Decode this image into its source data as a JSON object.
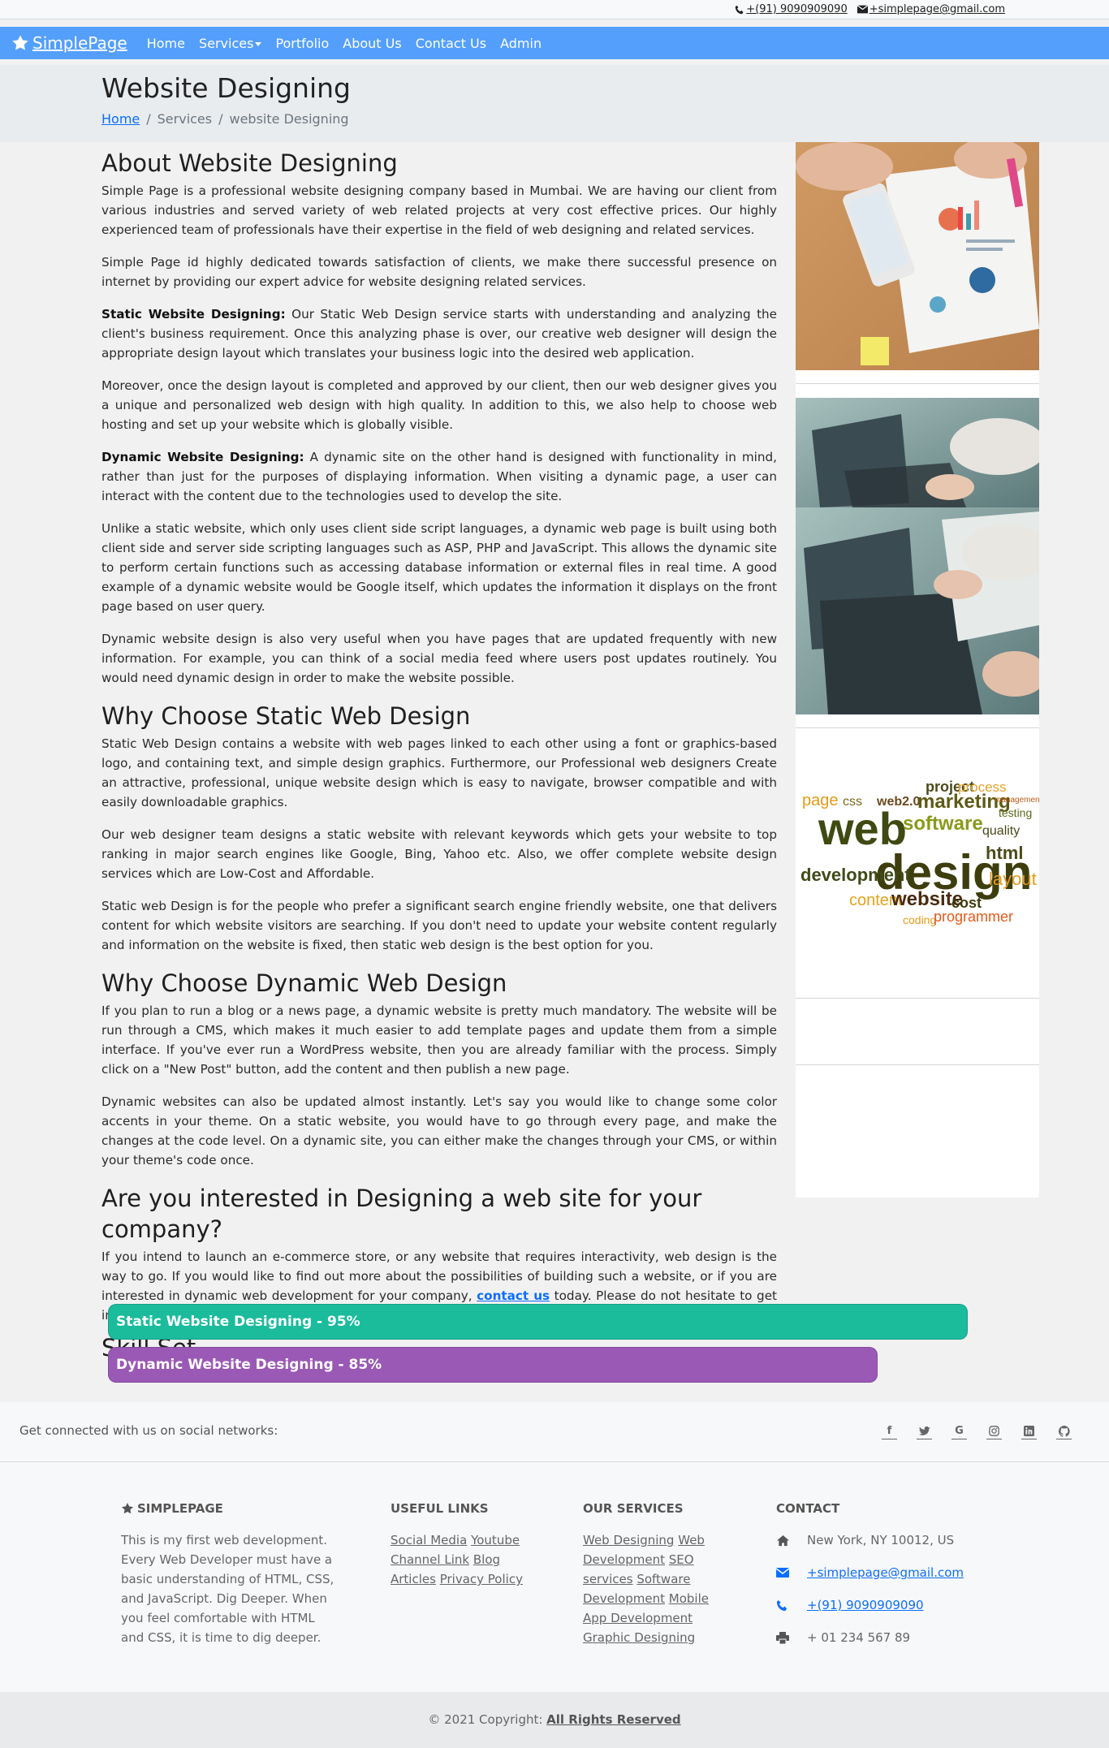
{
  "topbar": {
    "phone": "+(91) 9090909090",
    "email": "+simplepage@gmail.com"
  },
  "nav": {
    "brand": "SimplePage",
    "items": [
      "Home",
      "Services",
      "Portfolio",
      "About Us",
      "Contact Us",
      "Admin"
    ]
  },
  "header": {
    "title": "Website Designing",
    "breadcrumb": [
      "Home",
      "Services",
      "website Designing"
    ]
  },
  "about": {
    "heading": "About Website Designing",
    "p1": "Simple Page is a professional website designing company based in Mumbai. We are having our client from various industries and served variety of web related projects at very cost effective prices. Our highly experienced team of professionals have their expertise in the field of web designing and related services.",
    "p2": "Simple Page id highly dedicated towards satisfaction of clients, we make there successful presence on internet by providing our expert advice for website designing related services.",
    "static_label": "Static Website Designing:",
    "static_text": " Our Static Web Design service starts with understanding and analyzing the client's business requirement. Once this analyzing phase is over, our creative web designer will design the appropriate design layout which translates your business logic into the desired web application.",
    "p4": "Moreover, once the design layout is completed and approved by our client, then our web designer gives you a unique and personalized web design with high quality. In addition to this, we also help to choose web hosting and set up your website which is globally visible.",
    "dynamic_label": "Dynamic Website Designing:",
    "dynamic_text": " A dynamic site on the other hand is designed with functionality in mind, rather than just for the purposes of displaying information. When visiting a dynamic page, a user can interact with the content due to the technologies used to develop the site.",
    "p6": "Unlike a static website, which only uses client side script languages, a dynamic web page is built using both client side and server side scripting languages such as ASP, PHP and JavaScript. This allows the dynamic site to perform certain functions such as accessing database information or external files in real time. A good example of a dynamic website would be Google itself, which updates the information it displays on the front page based on user query.",
    "p7": "Dynamic website design is also very useful when you have pages that are updated frequently with new information. For example, you can think of a social media feed where users post updates routinely. You would need dynamic design in order to make the website possible."
  },
  "why_static": {
    "heading": "Why Choose Static Web Design",
    "p1": "Static Web Design contains a website with web pages linked to each other using a font or graphics-based logo, and containing text, and simple design graphics. Furthermore, our Professional web designers Create an attractive, professional, unique website design which is easy to navigate, browser compatible and with easily downloadable graphics.",
    "p2": "Our web designer team designs a static website with relevant keywords which gets your website to top ranking in major search engines like Google, Bing, Yahoo etc. Also, we offer complete website design services which are Low-Cost and Affordable.",
    "p3": "Static web Design is for the people who prefer a significant search engine friendly website, one that delivers content for which website visitors are searching. If you don't need to update your website content regularly and information on the website is fixed, then static web design is the best option for you."
  },
  "why_dynamic": {
    "heading": "Why Choose Dynamic Web Design",
    "p1": "If you plan to run a blog or a news page, a dynamic website is pretty much mandatory. The website will be run through a CMS, which makes it much easier to add template pages and update them from a simple interface. If you've ever run a WordPress website, then you are already familiar with the process. Simply click on a \"New Post\" button, add the content and then publish a new page.",
    "p2": "Dynamic websites can also be updated almost instantly. Let's say you would like to change some color accents in your theme. On a static website, you would have to go through every page, and make the changes at the code level. On a dynamic site, you can either make the changes through your CMS, or within your theme's code once."
  },
  "interested": {
    "heading": "Are you interested in Designing a web site for your company?",
    "text_before": "If you intend to launch an e-commerce store, or any website that requires interactivity, web design is the way to go. If you would like to find out more about the possibilities of building such a website, or if you are interested in dynamic web development for your company, ",
    "link": "contact us",
    "text_after": " today. Please do not hesitate to get in touch with any questions you may have."
  },
  "skills": {
    "heading": "Skill Set",
    "items": [
      {
        "label": "Static Website Designing - 95%",
        "percent": 95,
        "color": "#1abc9c"
      },
      {
        "label": "Dynamic Website Designing - 85%",
        "percent": 85,
        "color": "#9b59b6"
      }
    ]
  },
  "sidebar": {
    "word_cloud": [
      "project",
      "process",
      "page",
      "css",
      "web2.0",
      "marketing",
      "management",
      "testing",
      "web",
      "software",
      "quality",
      "design",
      "html",
      "development",
      "layout",
      "content",
      "website",
      "cost",
      "coding",
      "programmer"
    ]
  },
  "social": {
    "text": "Get connected with us on social networks:",
    "icons": [
      "facebook-icon",
      "twitter-icon",
      "google-icon",
      "instagram-icon",
      "linkedin-icon",
      "github-icon"
    ]
  },
  "footer": {
    "brand": "SIMPLEPAGE",
    "about": "This is my first web development. Every Web Developer must have a basic understanding of HTML, CSS, and JavaScript. Dig Deeper. When you feel comfortable with HTML and CSS, it is time to dig deeper.",
    "useful_links_title": "USEFUL LINKS",
    "useful_links": [
      "Social Media",
      "Youtube",
      "Channel Link",
      "Blog",
      "Articles",
      "Privacy Policy"
    ],
    "services_title": "OUR SERVICES",
    "services": [
      "Web Designing",
      "Web Development",
      "SEO services",
      "Software Development",
      "Mobile App Development",
      "Graphic Designing"
    ],
    "contact_title": "CONTACT",
    "address": "New York, NY 10012, US",
    "email": "+simplepage@gmail.com",
    "phone": "+(91) 9090909090",
    "fax": "+ 01 234 567 89"
  },
  "copyright": {
    "text": "© 2021 Copyright: ",
    "link": "All Rights Reserved"
  }
}
